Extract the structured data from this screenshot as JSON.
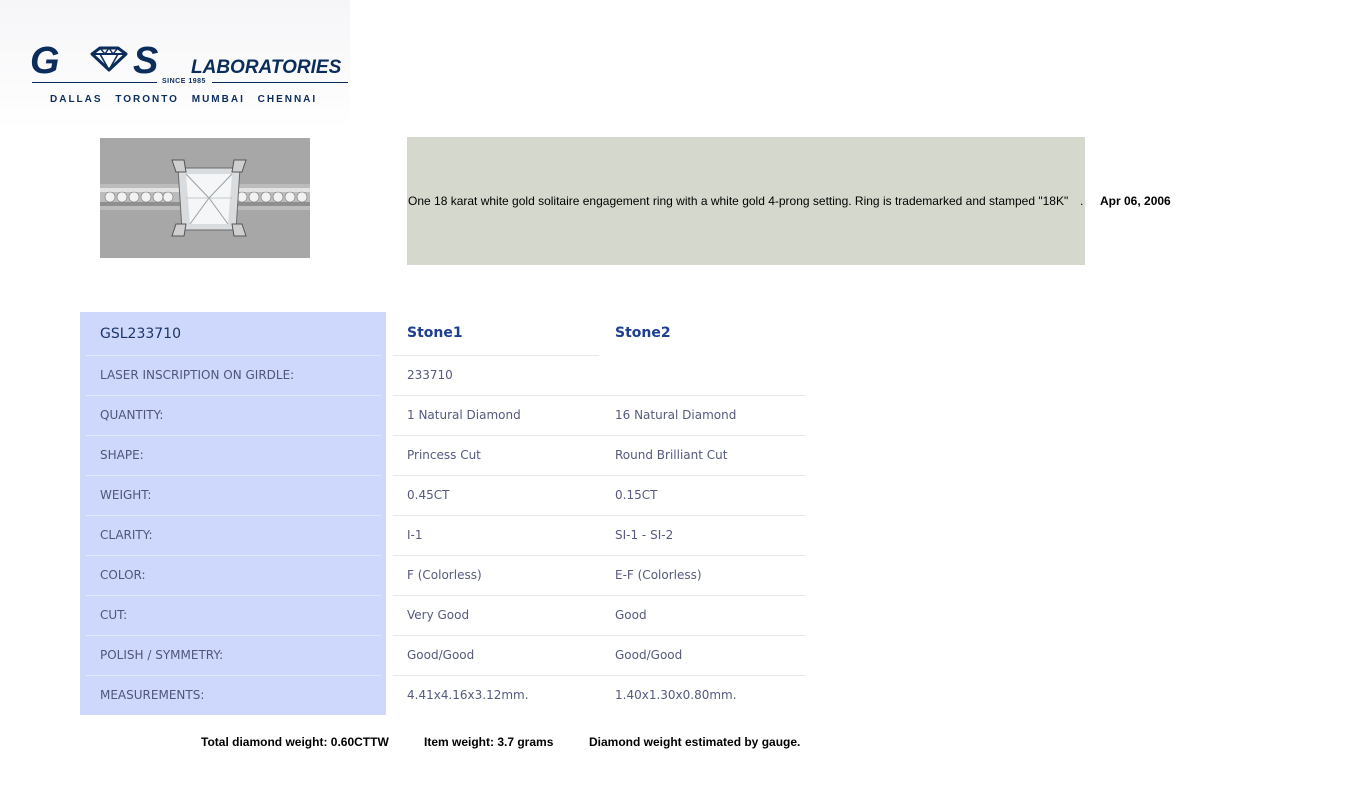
{
  "logo": {
    "brand_left": "G",
    "brand_right": "S",
    "brand_word": "LABORATORIES",
    "since": "SINCE 1985",
    "cities": "DALLAS TORONTO MUMBAI CHENNAI",
    "colors": {
      "navy": "#0b2d5c"
    }
  },
  "item": {
    "photo_icon": "ring-photo",
    "description": "One 18 karat white gold solitaire engagement ring with a white gold 4-prong setting. Ring is trademarked and stamped \"18K\"",
    "separator": ".",
    "date": "Apr 06, 2006"
  },
  "specs": {
    "report_id": "GSL233710",
    "stone_headers": [
      "Stone1",
      "Stone2"
    ],
    "rows": [
      {
        "label": "LASER INSCRIPTION ON GIRDLE:",
        "stone1": "233710",
        "stone2": ""
      },
      {
        "label": "QUANTITY:",
        "stone1": "1 Natural Diamond",
        "stone2": "16 Natural Diamond"
      },
      {
        "label": "SHAPE:",
        "stone1": "Princess Cut",
        "stone2": "Round Brilliant Cut"
      },
      {
        "label": "WEIGHT:",
        "stone1": "0.45CT",
        "stone2": "0.15CT"
      },
      {
        "label": "CLARITY:",
        "stone1": "I-1",
        "stone2": "SI-1 - SI-2"
      },
      {
        "label": "COLOR:",
        "stone1": "F (Colorless)",
        "stone2": "E-F (Colorless)"
      },
      {
        "label": "CUT:",
        "stone1": "Very Good",
        "stone2": "Good"
      },
      {
        "label": "POLISH / SYMMETRY:",
        "stone1": "Good/Good",
        "stone2": "Good/Good"
      },
      {
        "label": "MEASUREMENTS:",
        "stone1": "4.41x4.16x3.12mm.",
        "stone2": "1.40x1.30x0.80mm."
      }
    ],
    "colors": {
      "label_bg": "#ced7fc",
      "header_text": "#1c3f8f",
      "value_text": "#555a7e"
    }
  },
  "footer": {
    "total_weight": "Total diamond weight: 0.60CTTW",
    "item_weight": "Item weight: 3.7 grams",
    "note": "Diamond weight estimated by gauge."
  }
}
